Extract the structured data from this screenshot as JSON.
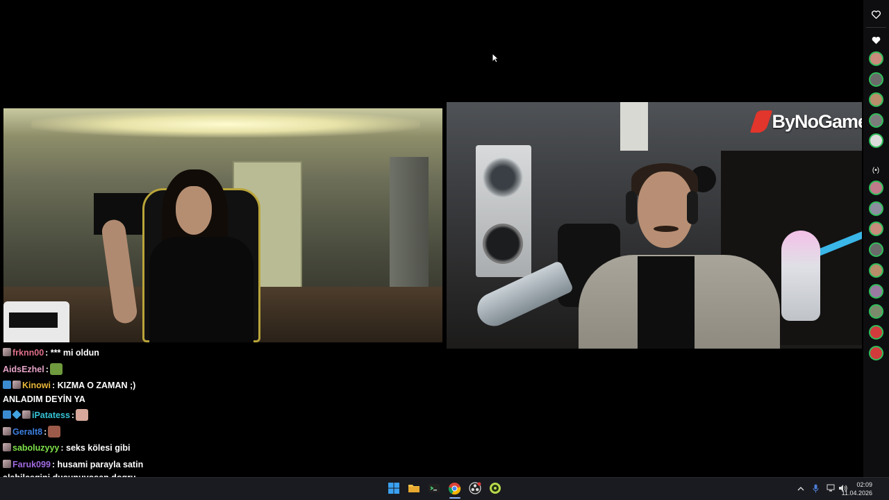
{
  "brand": {
    "logo_text": "ByNoGame",
    "accent": "#e2352c"
  },
  "chat": {
    "messages": [
      {
        "user": "frknn00",
        "user_color": "#e0708a",
        "text": ": *** mi oldun",
        "badges": [
          "sub"
        ]
      },
      {
        "user": "AidsEzhel",
        "user_color": "#e6a3c8",
        "text": ":",
        "badges": [],
        "emote": "frog-emote"
      },
      {
        "user": "Kinowi",
        "user_color": "#e8b73a",
        "text": ": KIZMA O ZAMAN ;) ANLADIM DEYİN YA",
        "badges": [
          "x",
          "sub"
        ]
      },
      {
        "user": "iPatatess",
        "user_color": "#35c3d6",
        "text": ":",
        "badges": [
          "x",
          "gem",
          "sub"
        ],
        "emote": "face-emote"
      },
      {
        "user": "Geralt8",
        "user_color": "#3d7fe0",
        "text": ":",
        "badges": [
          "sub"
        ],
        "emote": "meme-emote"
      },
      {
        "user": "saboluzyyy",
        "user_color": "#7ee04a",
        "text": ": seks kölesi gibi",
        "badges": [
          "sub"
        ]
      },
      {
        "user": "Faruk099",
        "user_color": "#a06ae0",
        "text": ": husami parayla satin alabilcegini dusunuyosan dogru dusunuyosun",
        "badges": [
          "sub"
        ]
      }
    ]
  },
  "rail": {
    "top_icons": [
      "heart-outline-icon",
      "heart-icon"
    ],
    "live_icon": "broadcast-icon",
    "avatar_count_top": 5,
    "avatar_count_bottom": 9
  },
  "taskbar": {
    "apps": [
      "windows-start-icon",
      "file-explorer-icon",
      "terminal-icon",
      "chrome-icon",
      "obs-icon",
      "green-app-icon"
    ],
    "time": "02:09",
    "date": "11.04.2026"
  }
}
